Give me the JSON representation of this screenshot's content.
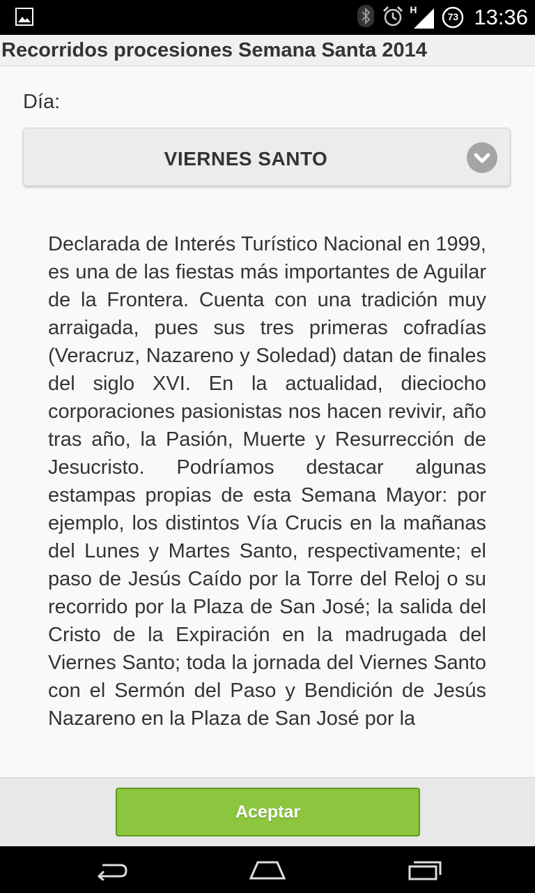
{
  "status_bar": {
    "time": "13:36",
    "battery_level": "73",
    "network_type": "H",
    "icons": [
      "image-icon",
      "bluetooth-icon",
      "alarm-icon",
      "signal-icon",
      "battery-icon"
    ]
  },
  "header": {
    "title": "Recorridos procesiones Semana Santa 2014"
  },
  "form": {
    "day_label": "Día:",
    "day_selected": "VIERNES SANTO"
  },
  "description": "Declarada de Interés Turístico Nacional en 1999, es una de las fiestas más importantes de Aguilar de la Frontera. Cuenta con una tradición muy arraigada, pues sus tres primeras cofradías (Veracruz, Nazareno y Soledad) datan de finales del siglo XVI. En la actualidad, dieciocho corporaciones pasionistas nos hacen revivir, año tras año, la Pasión, Muerte y Resurrección de Jesucristo. Podríamos destacar algunas estampas propias de esta Semana Mayor: por ejemplo, los distintos Vía Crucis en la mañanas del Lunes y Martes Santo, respectivamente; el paso de Jesús Caído por la Torre del Reloj o su recorrido por la Plaza de San José; la salida del Cristo de la Expiración en la madrugada del Viernes Santo; toda la jornada del Viernes Santo con el Sermón del Paso y Bendición de Jesús Nazareno en la Plaza de San José por la",
  "footer": {
    "accept_label": "Aceptar"
  },
  "colors": {
    "accent_green": "#8cc63f",
    "status_bar_bg": "#000000"
  }
}
